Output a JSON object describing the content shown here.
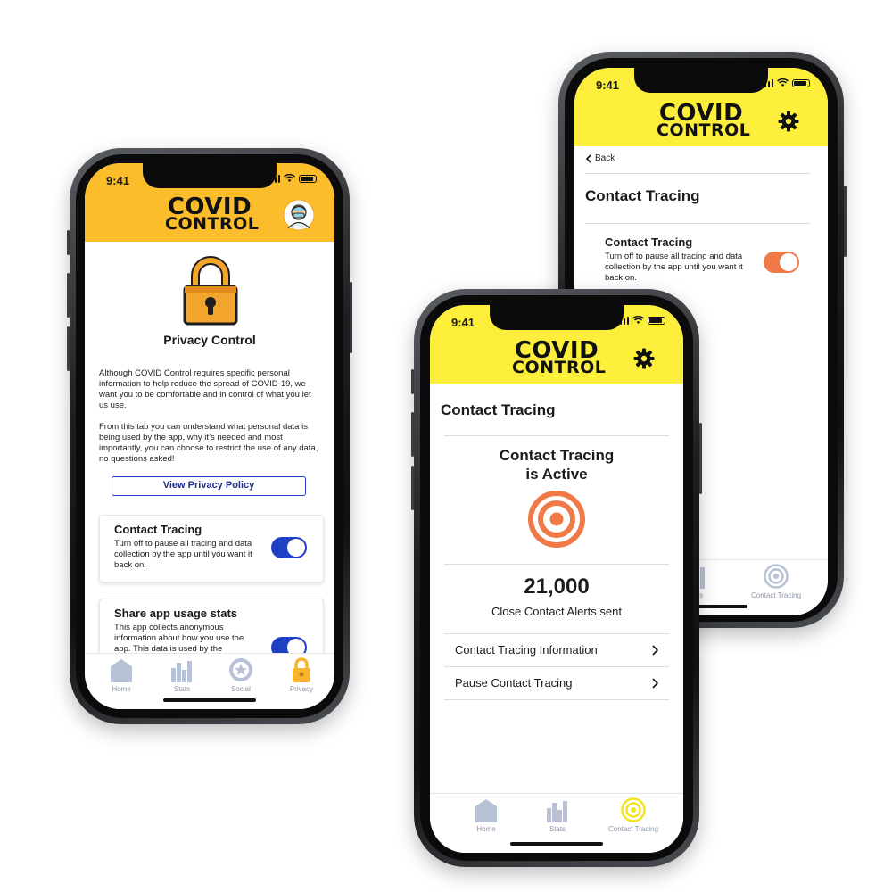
{
  "colors": {
    "orange_header": "#fbbd2b",
    "yellow_header": "#fdee3c",
    "toggle_blue": "#1f3fc6",
    "toggle_orange": "#ef7a48",
    "target": "#ef7a48"
  },
  "left_phone": {
    "time": "9:41",
    "brand_line1": "COVID",
    "brand_line2": "CONTROL",
    "avatar_icon": "doctor-avatar-icon",
    "hero_icon": "padlock-icon",
    "title": "Privacy Control",
    "para1": "Although COVID Control requires specific personal information to help reduce the spread of COVID-19, we want you to be comfortable and in control of what you let us use.",
    "para2": "From this tab you can understand what personal data is being used by the app, why it’s needed and most importantly, you can choose to restrict the use of any data, no questions asked!",
    "policy_button": "View Privacy Policy",
    "card1": {
      "title": "Contact Tracing",
      "desc": "Turn off to pause all tracing and data collection by the app until you want it back on.",
      "enabled": true
    },
    "card2": {
      "title": "Share app usage stats",
      "desc": "This app collects anonymous information about how you use the app. This data is used by the",
      "enabled": true
    },
    "tabs": [
      {
        "label": "Home",
        "icon": "home-icon"
      },
      {
        "label": "Stats",
        "icon": "stats-icon"
      },
      {
        "label": "Social",
        "icon": "social-badge-icon"
      },
      {
        "label": "Privacy",
        "icon": "padlock-icon",
        "active": true
      }
    ]
  },
  "back_phone": {
    "time": "9:41",
    "brand_line1": "COVID",
    "brand_line2": "CONTROL",
    "back_label": "Back",
    "title": "Contact Tracing",
    "setting_title": "Contact Tracing",
    "setting_desc": "Turn off to pause all tracing and data collection by the app until you want it back on.",
    "setting_enabled": true,
    "tabs": [
      {
        "label": "Stats",
        "icon": "stats-icon"
      },
      {
        "label": "Contact Tracing",
        "icon": "target-icon"
      }
    ]
  },
  "front_phone": {
    "time": "9:41",
    "brand_line1": "COVID",
    "brand_line2": "CONTROL",
    "title": "Contact Tracing",
    "status_line1": "Contact Tracing",
    "status_line2": "is Active",
    "alerts_count": "21,000",
    "alerts_label": "Close Contact Alerts sent",
    "menu": [
      {
        "label": "Contact Tracing Information"
      },
      {
        "label": "Pause Contact Tracing"
      }
    ],
    "tabs": [
      {
        "label": "Home",
        "icon": "home-icon"
      },
      {
        "label": "Stats",
        "icon": "stats-icon"
      },
      {
        "label": "Contact Tracing",
        "icon": "target-icon",
        "active": true
      }
    ]
  }
}
